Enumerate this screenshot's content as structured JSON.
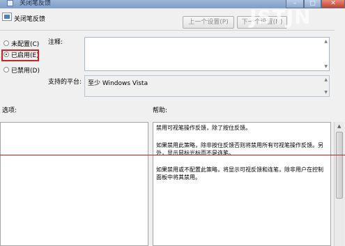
{
  "window": {
    "title": "关闭笔反馈",
    "controls": {
      "minimize": "–",
      "maximize": "□",
      "close": "✕"
    }
  },
  "header": {
    "title": "关闭笔反馈",
    "prev_setting": "上一个设置(P)",
    "next_setting": "下一个设置(N)"
  },
  "radios": [
    {
      "label": "未配置(C)",
      "selected": false
    },
    {
      "label": "已启用(E)",
      "selected": true
    },
    {
      "label": "已禁用(D)",
      "selected": false
    }
  ],
  "comment": {
    "label": "注释:",
    "value": ""
  },
  "supported": {
    "label": "支持的平台:",
    "value": "至少 Windows Vista"
  },
  "options": {
    "label": "选项:"
  },
  "help": {
    "label": "帮助:",
    "paragraphs": [
      "禁用可视笔操作反馈，除了按住反馈。",
      "如果禁用此策略，除非按住反馈否则将禁用所有可视笔操作反馈。另外，显示鼠标光标而不是连笔。",
      "如果禁用或不配置此策略，将显示可视反馈和连笔，除非用户在控制面板中将其禁用。"
    ]
  },
  "watermark": "JSTJN",
  "colors": {
    "highlight": "#d21f26",
    "titlebar": "#8ca8cf",
    "close_button": "#c4412a"
  }
}
